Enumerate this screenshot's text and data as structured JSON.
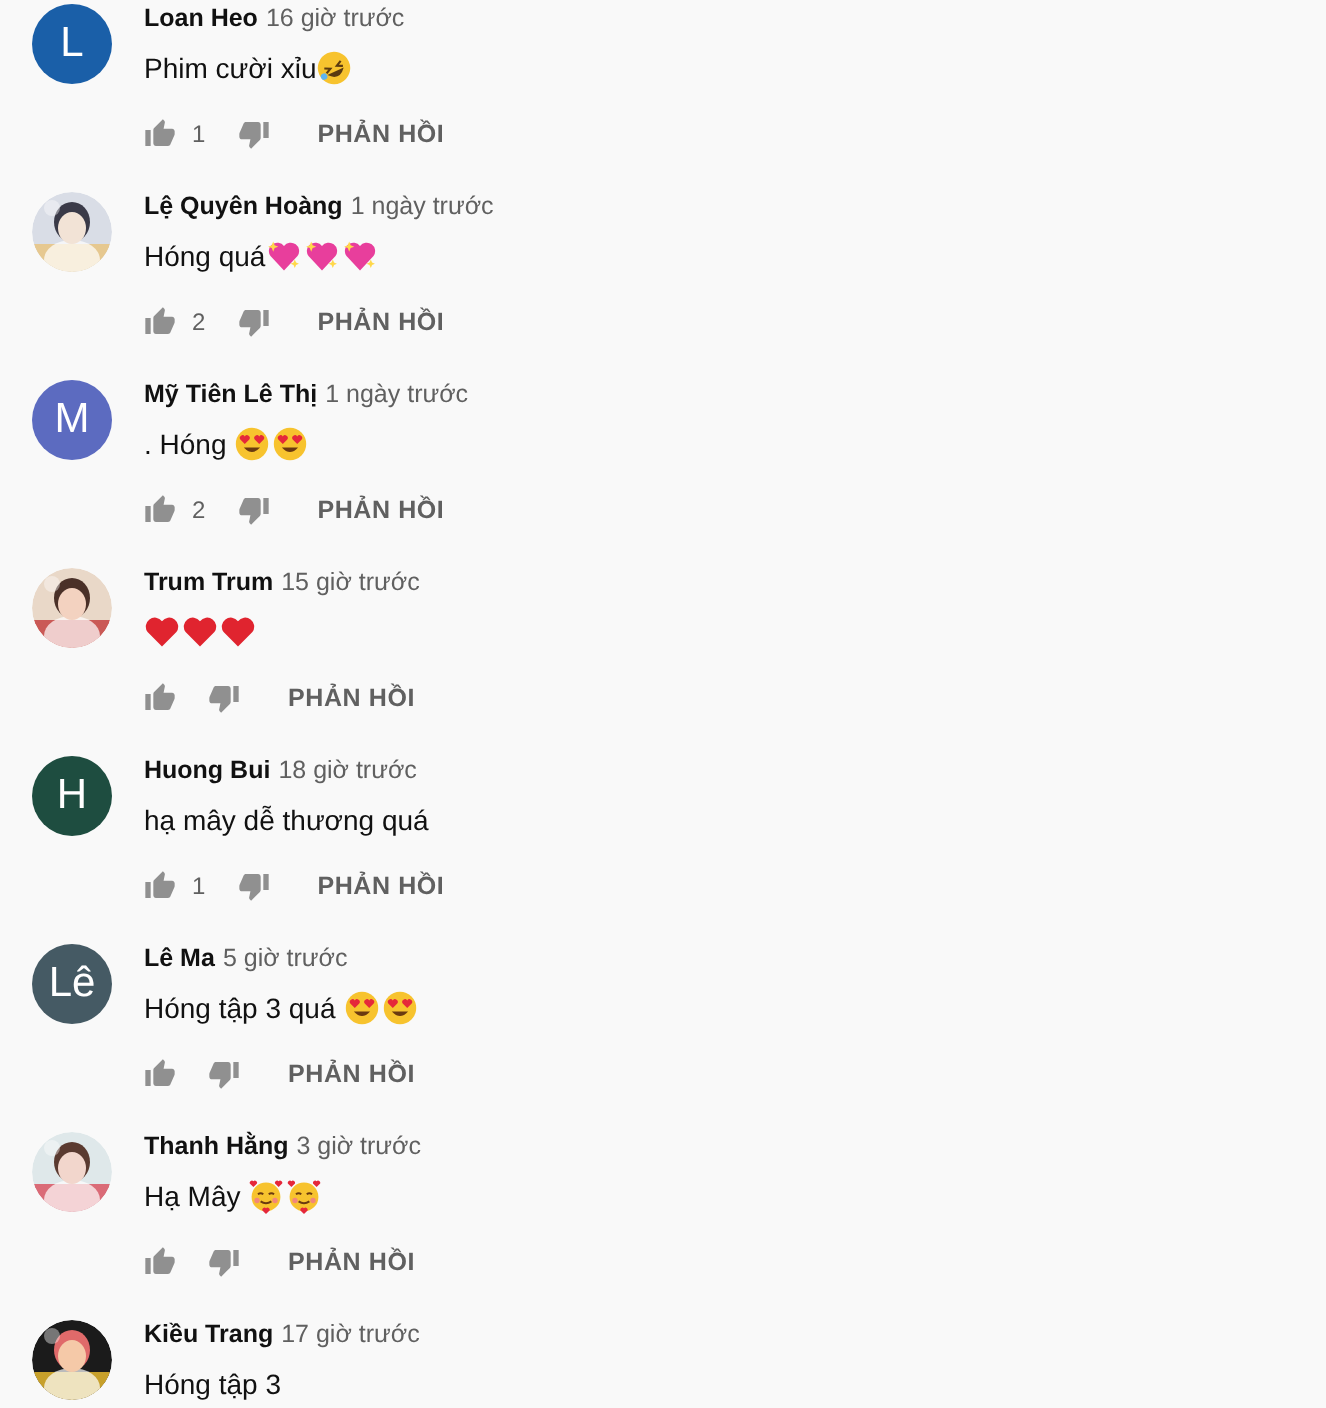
{
  "comments": [
    {
      "author": "Loan Heo",
      "time": "16 giờ trước",
      "text": "Phim cười xỉu",
      "emojis": [
        {
          "kind": "rofl"
        }
      ],
      "avatar": {
        "kind": "letter",
        "letter": "L",
        "color": "#1a5fa8"
      },
      "likes": "1",
      "reply": "PHẢN HỒI"
    },
    {
      "author": "Lệ Quyên Hoàng",
      "time": "1 ngày trước",
      "text": "Hóng quá",
      "emojis": [
        {
          "kind": "sparkling-heart"
        },
        {
          "kind": "sparkling-heart"
        },
        {
          "kind": "sparkling-heart"
        }
      ],
      "avatar": {
        "kind": "picture"
      },
      "likes": "2",
      "reply": "PHẢN HỒI"
    },
    {
      "author": "Mỹ Tiên Lê Thị",
      "time": "1 ngày trước",
      "text": ". Hóng ",
      "emojis": [
        {
          "kind": "heart-eyes"
        },
        {
          "kind": "heart-eyes"
        }
      ],
      "avatar": {
        "kind": "letter",
        "letter": "M",
        "color": "#5c6bc0"
      },
      "likes": "2",
      "reply": "PHẢN HỒI"
    },
    {
      "author": "Trum Trum",
      "time": "15 giờ trước",
      "emojis": [
        {
          "kind": "red-heart"
        },
        {
          "kind": "red-heart"
        },
        {
          "kind": "red-heart"
        }
      ],
      "avatar": {
        "kind": "picture"
      },
      "reply": "PHẢN HỒI"
    },
    {
      "author": "Huong Bui",
      "time": "18 giờ trước",
      "text": "hạ mây dễ thương quá",
      "avatar": {
        "kind": "letter",
        "letter": "H",
        "color": "#1e4d40"
      },
      "likes": "1",
      "reply": "PHẢN HỒI"
    },
    {
      "author": "Lê Ma",
      "time": "5 giờ trước",
      "text": "Hóng tập 3 quá ",
      "emojis": [
        {
          "kind": "heart-eyes"
        },
        {
          "kind": "heart-eyes"
        }
      ],
      "avatar": {
        "kind": "letter",
        "letter": "Lê",
        "color": "#455a64"
      },
      "reply": "PHẢN HỒI"
    },
    {
      "author": "Thanh Hằng",
      "time": "3 giờ trước",
      "text": "Hạ Mây ",
      "emojis": [
        {
          "kind": "smiling-hearts"
        },
        {
          "kind": "smiling-hearts"
        }
      ],
      "avatar": {
        "kind": "picture"
      },
      "reply": "PHẢN HỒI"
    },
    {
      "author": "Kiều Trang",
      "time": "17 giờ trước",
      "text": "Hóng tập 3",
      "avatar": {
        "kind": "picture"
      }
    }
  ]
}
